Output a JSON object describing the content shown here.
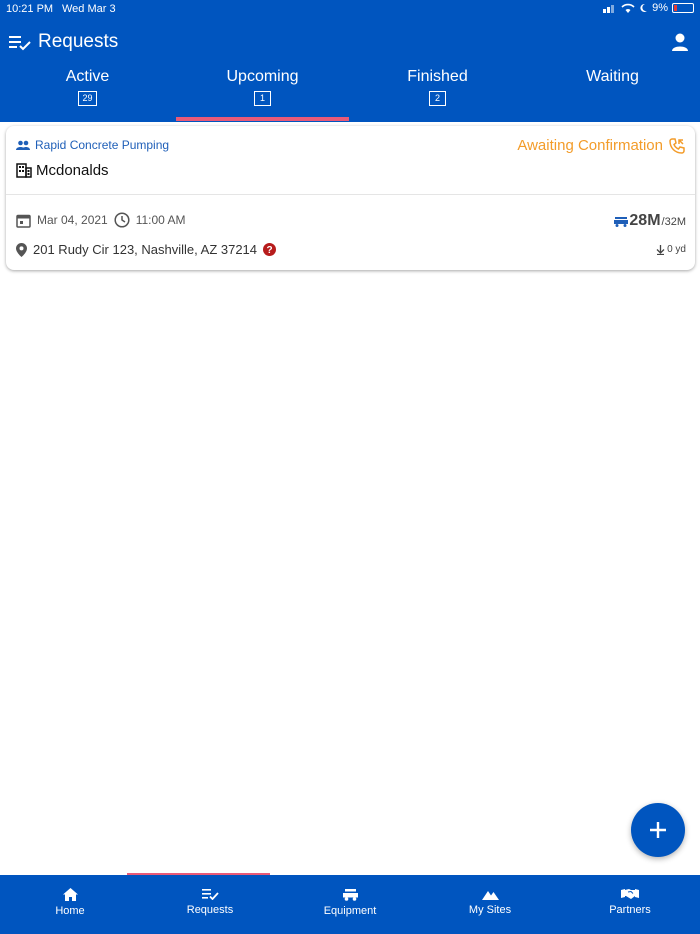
{
  "status_bar": {
    "time": "10:21 PM",
    "date": "Wed Mar 3",
    "battery": "9%"
  },
  "header": {
    "title": "Requests",
    "menu_icon": "checklist-icon",
    "user_icon": "user-icon"
  },
  "tabs": [
    {
      "label": "Active",
      "count": "29"
    },
    {
      "label": "Upcoming",
      "count": "1"
    },
    {
      "label": "Finished",
      "count": "2"
    },
    {
      "label": "Waiting",
      "count": ""
    }
  ],
  "active_tab": "Upcoming",
  "request_card": {
    "company": "Rapid Concrete Pumping",
    "status": "Awaiting Confirmation",
    "site_name": "Mcdonalds",
    "date": "Mar 04, 2021",
    "time": "11:00 AM",
    "address": "201 Rudy Cir 123, Nashville, AZ 37214",
    "boom_size": "28M",
    "boom_max": "/32M",
    "yardage": "0 yd"
  },
  "bottom_nav": [
    {
      "label": "Home",
      "icon": "home-icon"
    },
    {
      "label": "Requests",
      "icon": "checklist-icon"
    },
    {
      "label": "Equipment",
      "icon": "pump-truck-icon"
    },
    {
      "label": "My Sites",
      "icon": "mountains-icon"
    },
    {
      "label": "Partners",
      "icon": "handshake-icon"
    }
  ],
  "colors": {
    "primary": "#0055bf",
    "accent": "#e85a78",
    "status_orange": "#f39c2a",
    "company_blue": "#1f5fb8",
    "alert_red": "#b71c1c"
  }
}
